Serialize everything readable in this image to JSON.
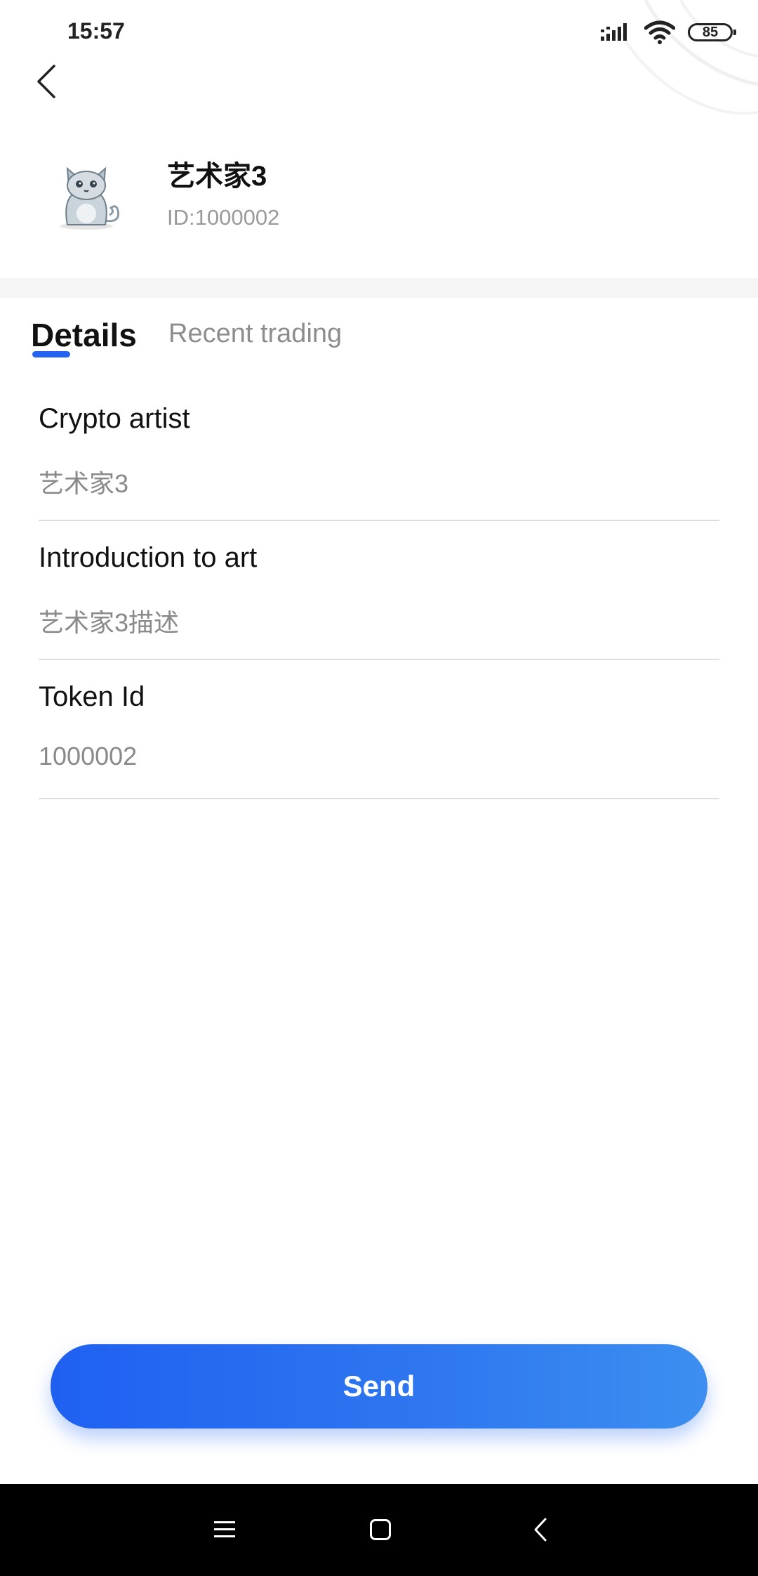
{
  "status_bar": {
    "time": "15:57",
    "battery_level": "85",
    "icons": [
      "signal-icon",
      "wifi-icon",
      "battery-icon"
    ]
  },
  "header": {
    "back_icon": "chevron-left-icon"
  },
  "profile": {
    "name": "艺术家3",
    "id_text": "ID:1000002",
    "avatar_icon": "cat-avatar-icon"
  },
  "tabs": [
    {
      "label": "Details",
      "active": true
    },
    {
      "label": "Recent trading",
      "active": false
    }
  ],
  "fields": [
    {
      "label": "Crypto artist",
      "value": "艺术家3"
    },
    {
      "label": "Introduction to art",
      "value": "艺术家3描述"
    },
    {
      "label": "Token Id",
      "value": "1000002"
    }
  ],
  "actions": {
    "send_label": "Send"
  },
  "nav_bar": {
    "icons": [
      "menu-icon",
      "home-square-icon",
      "back-triangle-icon"
    ]
  },
  "colors": {
    "accent": "#2462f2",
    "button_gradient_start": "#1f60f1",
    "button_gradient_end": "#3c8ff0",
    "muted_text": "#8a8a8a",
    "divider": "#dddddd"
  }
}
